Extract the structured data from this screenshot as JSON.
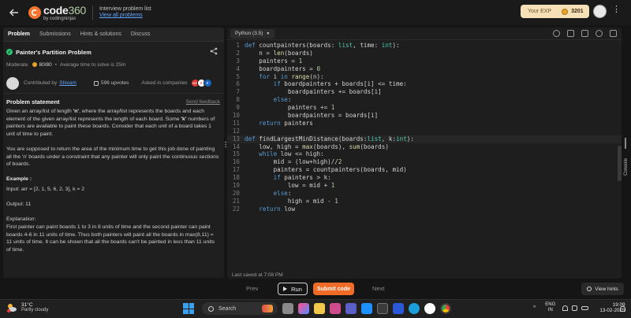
{
  "header": {
    "logo_text": "code",
    "logo_number": "360",
    "logo_sub": "by codingninjas",
    "crumb_title": "Interview problem list",
    "crumb_link": "View all problems",
    "exp_label": "Your EXP",
    "exp_value": "3201"
  },
  "tabs": [
    {
      "label": "Problem",
      "active": true
    },
    {
      "label": "Submissions",
      "active": false
    },
    {
      "label": "Hints & solutions",
      "active": false
    },
    {
      "label": "Discuss",
      "active": false
    }
  ],
  "problem": {
    "title": "Painter's Partition Problem",
    "difficulty": "Moderate",
    "score": "80/80",
    "avg_time": "Average time to solve is 25m",
    "contributed_by_label": "Contributed by",
    "contributor": "Shivam",
    "upvotes": "596 upvotes",
    "asked_in": "Asked in companies",
    "statement_heading": "Problem statement",
    "send_feedback": "Send feedback",
    "desc_1a": "Given an array/list of length ",
    "desc_1b": "'n'",
    "desc_1c": ", where the array/list represents the boards and each element of the given array/list represents the length of each board. Some ",
    "desc_1d": "'k'",
    "desc_1e": " numbers of painters are available to paint these boards. Consider that each unit of a board takes 1 unit of time to paint.",
    "desc_2": "You are supposed to return the area of the minimum time to get this job done of painting all the 'n' boards under a constraint that any painter will only paint the continuous sections of boards.",
    "example_heading": "Example :",
    "example_input": "Input: arr = [2, 1, 5, 6, 2, 3], k = 2",
    "example_output": "Output: 11",
    "explanation_heading": "Explanation:",
    "explanation": "First painter can paint boards 1 to 3 in 8 units of time and the second painter can paint boards 4-6 in 11 units of time. Thus both painters will paint all the boards in max(8,11) = 11 units of time. It can be shown that all the boards can't be painted in less than 11 units of time."
  },
  "editor": {
    "language": "Python (3.5)",
    "last_saved": "Last saved at 7:08 PM",
    "code_lines": [
      "def countpainters(boards: list, time: int):",
      "    n = len(boards)",
      "    painters = 1",
      "    boardpainters = 0",
      "    for i in range(n):",
      "        if boardpainters + boards[i] <= time:",
      "            boardpainters += boards[i]",
      "        else:",
      "            painters += 1",
      "            boardpainters = boards[i]",
      "    return painters",
      "",
      "def findLargestMinDistance(boards:list, k:int):",
      "    low, high = max(boards), sum(boards)",
      "    while low <= high:",
      "        mid = (low+high)//2",
      "        painters = countpainters(boards, mid)",
      "        if painters > k:",
      "            low = mid + 1",
      "        else:",
      "            high = mid - 1",
      "    return low"
    ]
  },
  "actions": {
    "prev": "Prev",
    "run": "Run",
    "submit": "Submit code",
    "next": "Next",
    "hints": "View hints",
    "console": "Console"
  },
  "taskbar": {
    "temp": "31°C",
    "condition": "Partly cloudy",
    "search": "Search",
    "lang_1": "ENG",
    "lang_2": "IN",
    "time": "19:09",
    "date": "13-02-2025"
  },
  "colors": {
    "accent": "#f06b25",
    "link": "#63a6ff",
    "success": "#2fbf71"
  }
}
